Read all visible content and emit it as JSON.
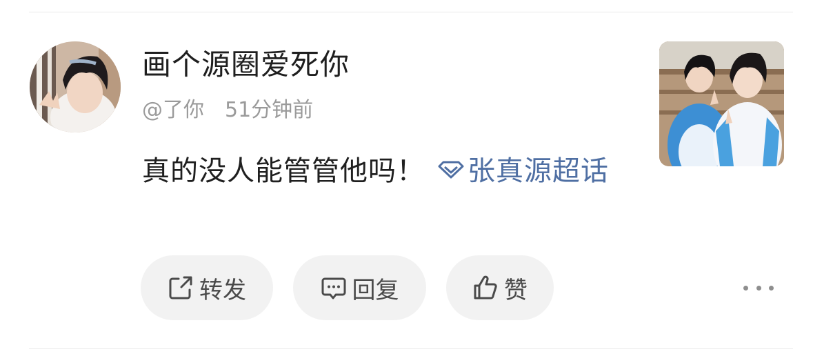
{
  "post": {
    "author_name": "画个源圈爱死你",
    "reply_to": "@了你",
    "time_ago": "51分钟前",
    "text": "真的没人能管管他吗！",
    "topic_label": "张真源超话"
  },
  "actions": {
    "repost_label": "转发",
    "reply_label": "回复",
    "like_label": "赞"
  },
  "icons": {
    "avatar": "avatar",
    "topic": "diamond-icon",
    "repost": "share-icon",
    "reply": "comment-icon",
    "like": "thumbs-up-icon",
    "more": "more-icon"
  },
  "colors": {
    "topic_link": "#4f6fa3",
    "button_bg": "#f2f2f2",
    "text_primary": "#1f1f1f",
    "text_secondary": "#9a9a9a"
  }
}
